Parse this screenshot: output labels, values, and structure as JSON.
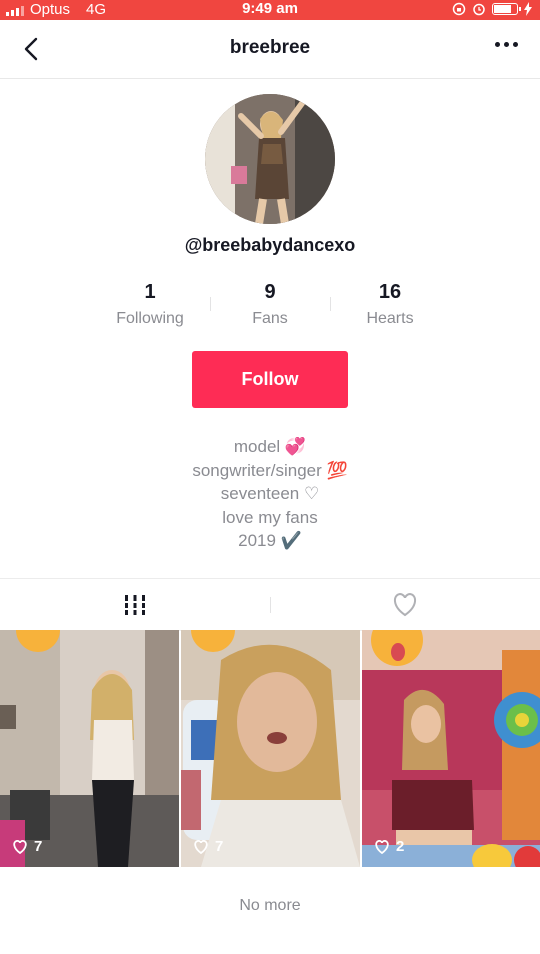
{
  "status": {
    "carrier": "Optus",
    "network": "4G",
    "time": "9:49 am"
  },
  "header": {
    "title": "breebree"
  },
  "profile": {
    "handle": "@breebabydancexo"
  },
  "stats": [
    {
      "value": "1",
      "label": "Following"
    },
    {
      "value": "9",
      "label": "Fans"
    },
    {
      "value": "16",
      "label": "Hearts"
    }
  ],
  "actions": {
    "follow_label": "Follow"
  },
  "bio": [
    "model 💞",
    "songwriter/singer 💯",
    "seventeen ♡",
    "love my fans",
    "2019 ✔️"
  ],
  "videos": [
    {
      "likes": "7"
    },
    {
      "likes": "7"
    },
    {
      "likes": "2"
    }
  ],
  "footer": {
    "no_more": "No more"
  },
  "colors": {
    "status_bar": "#f04640",
    "follow_button": "#fe2c55"
  },
  "icons": [
    "back-arrow-icon",
    "more-icon",
    "grid-icon",
    "heart-outline-icon",
    "heart-icon"
  ]
}
